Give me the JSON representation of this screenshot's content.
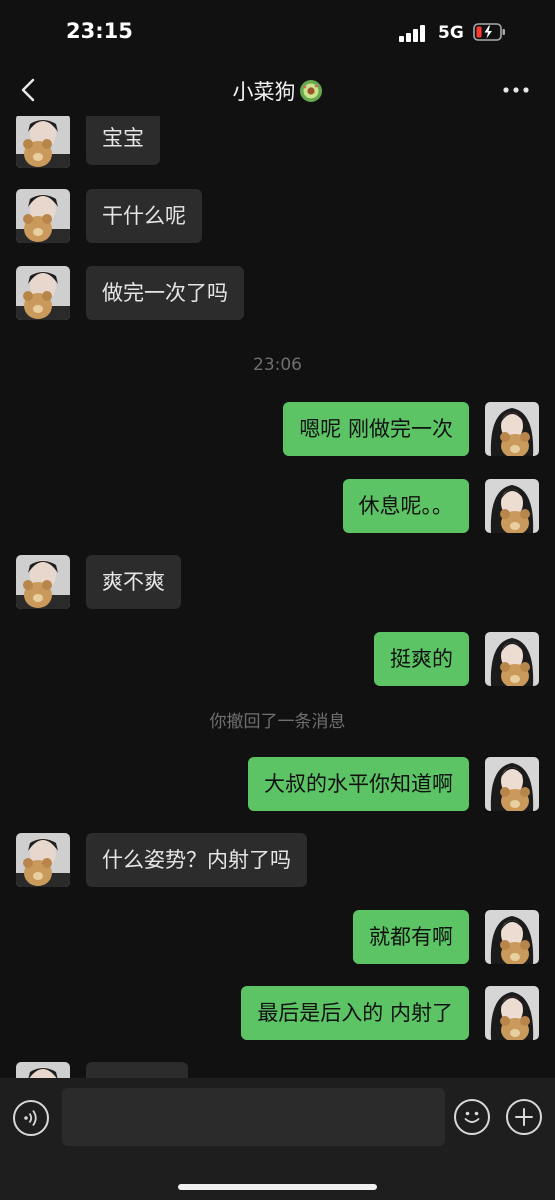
{
  "status": {
    "time": "23:15",
    "network": "5G",
    "battery_color": "#ff3b30"
  },
  "header": {
    "title": "小菜狗",
    "title_emoji": "avocado-emoji"
  },
  "messages": [
    {
      "side": "in",
      "text": "宝宝"
    },
    {
      "side": "in",
      "text": "干什么呢"
    },
    {
      "side": "in",
      "text": "做完一次了吗"
    },
    {
      "system": "23:06"
    },
    {
      "side": "out",
      "text": "嗯呢 刚做完一次"
    },
    {
      "side": "out",
      "text": "休息呢。。"
    },
    {
      "side": "in",
      "text": "爽不爽"
    },
    {
      "side": "out",
      "text": "挺爽的"
    },
    {
      "system": "你撤回了一条消息"
    },
    {
      "side": "out",
      "text": "大叔的水平你知道啊"
    },
    {
      "side": "in",
      "text": "什么姿势？内射了吗"
    },
    {
      "side": "out",
      "text": "就都有啊"
    },
    {
      "side": "out",
      "text": "最后是后入的 内射了"
    }
  ],
  "colors": {
    "background": "#111111",
    "incoming_bubble": "#2c2c2c",
    "outgoing_bubble": "#5cc465"
  },
  "input": {
    "placeholder": ""
  }
}
